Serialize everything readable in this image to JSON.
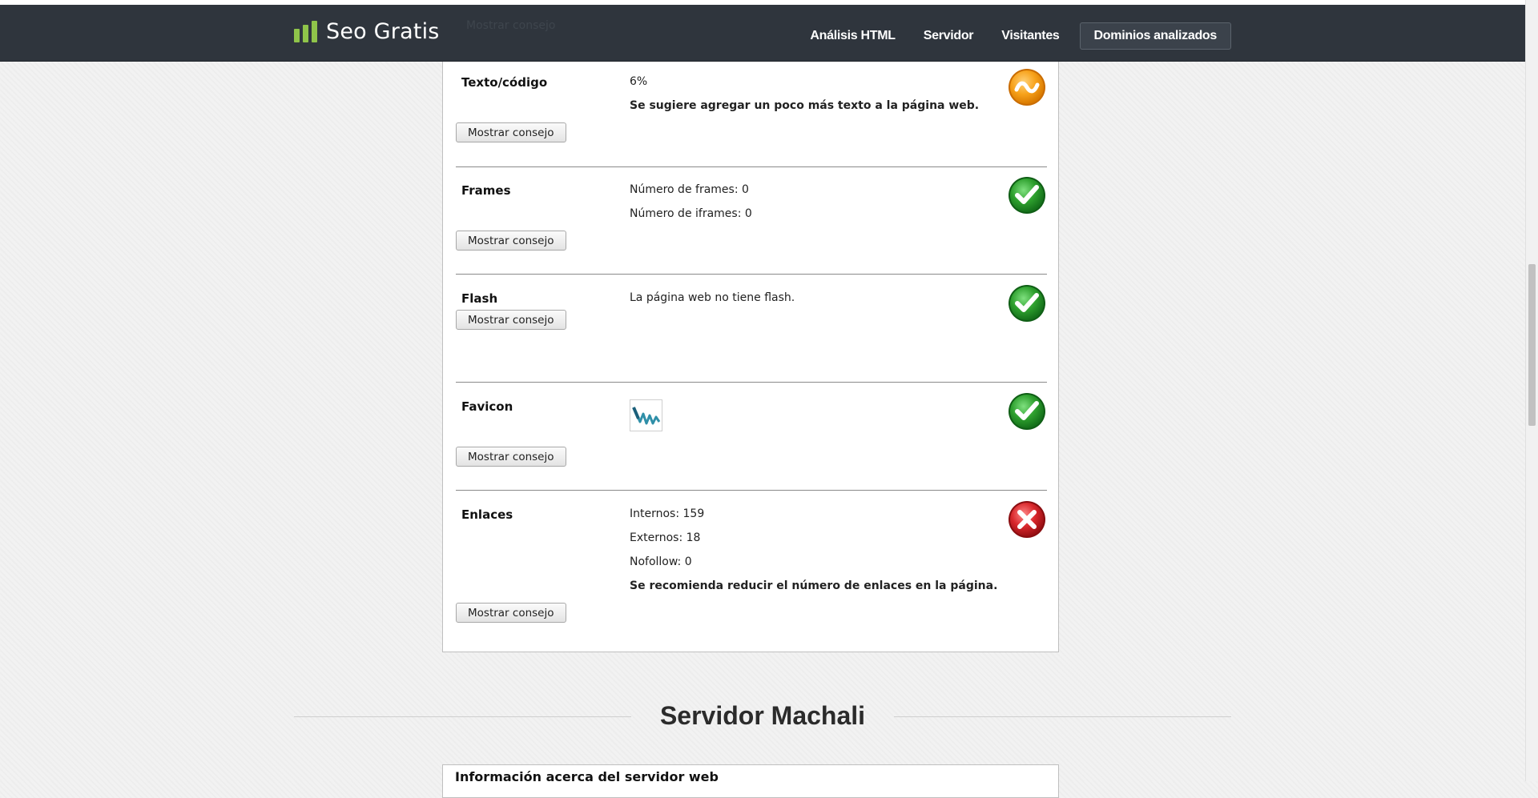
{
  "navbar": {
    "brand": "Seo Gratis",
    "ghost_text": "Mostrar consejo",
    "links": [
      "Análisis HTML",
      "Servidor",
      "Visitantes",
      "Dominios analizados"
    ]
  },
  "rows": [
    {
      "label": "Texto/código",
      "lines": [
        "6%",
        "Se sugiere agregar un poco más texto a la página web."
      ],
      "button": "Mostrar consejo",
      "status": "warning",
      "status_icon": "warning-wave-icon"
    },
    {
      "label": "Frames",
      "lines": [
        "Número de frames: 0",
        "Número de iframes: 0"
      ],
      "button": "Mostrar consejo",
      "status": "ok",
      "status_icon": "check-icon"
    },
    {
      "label": "Flash",
      "lines": [
        "La página web no tiene flash."
      ],
      "button": "Mostrar consejo",
      "status": "ok",
      "status_icon": "check-icon"
    },
    {
      "label": "Favicon",
      "lines": [],
      "favicon_icon": "site-favicon-icon",
      "button": "Mostrar consejo",
      "status": "ok",
      "status_icon": "check-icon"
    },
    {
      "label": "Enlaces",
      "lines": [
        "Internos: 159",
        "Externos: 18",
        "Nofollow: 0",
        "Se recomienda reducir el número de enlaces en la página."
      ],
      "button": "Mostrar consejo",
      "status": "error",
      "status_icon": "cross-icon"
    }
  ],
  "section": {
    "title": "Servidor Machali",
    "panel_title": "Información acerca del servidor web"
  },
  "colors": {
    "navbar": "#2f353d",
    "brand_green": "#8fc44a",
    "ok": "#2ea02e",
    "warning": "#f39c12",
    "error": "#d9282c"
  }
}
